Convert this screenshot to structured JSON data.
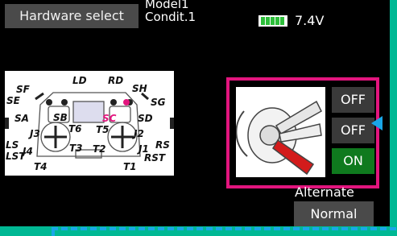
{
  "header": {
    "title_button": "Hardware select",
    "model_name": "Model1",
    "condition": "Condit.1",
    "battery_voltage": "7.4V",
    "battery_level_fraction": 1.0
  },
  "transmitter": {
    "switch_labels": [
      "SF",
      "LD",
      "RD",
      "SH",
      "SE",
      "SG",
      "SA",
      "SB",
      "SC",
      "SD",
      "J3",
      "T6",
      "T5",
      "J2",
      "LS",
      "J4",
      "T3",
      "T2",
      "J1",
      "RS",
      "LST",
      "T4",
      "T1",
      "RST"
    ],
    "highlighted_switch": "SC"
  },
  "switch_settings": {
    "positions": [
      "OFF",
      "OFF",
      "ON"
    ],
    "mode_label": "Alternate",
    "mode_value": "Normal"
  },
  "colors": {
    "accent_frame": "#e3157e",
    "on_button": "#0f7a1e",
    "pointer_arrow": "#1aa6e8",
    "background": "#00b894",
    "highlight_label": "#e3157e"
  }
}
